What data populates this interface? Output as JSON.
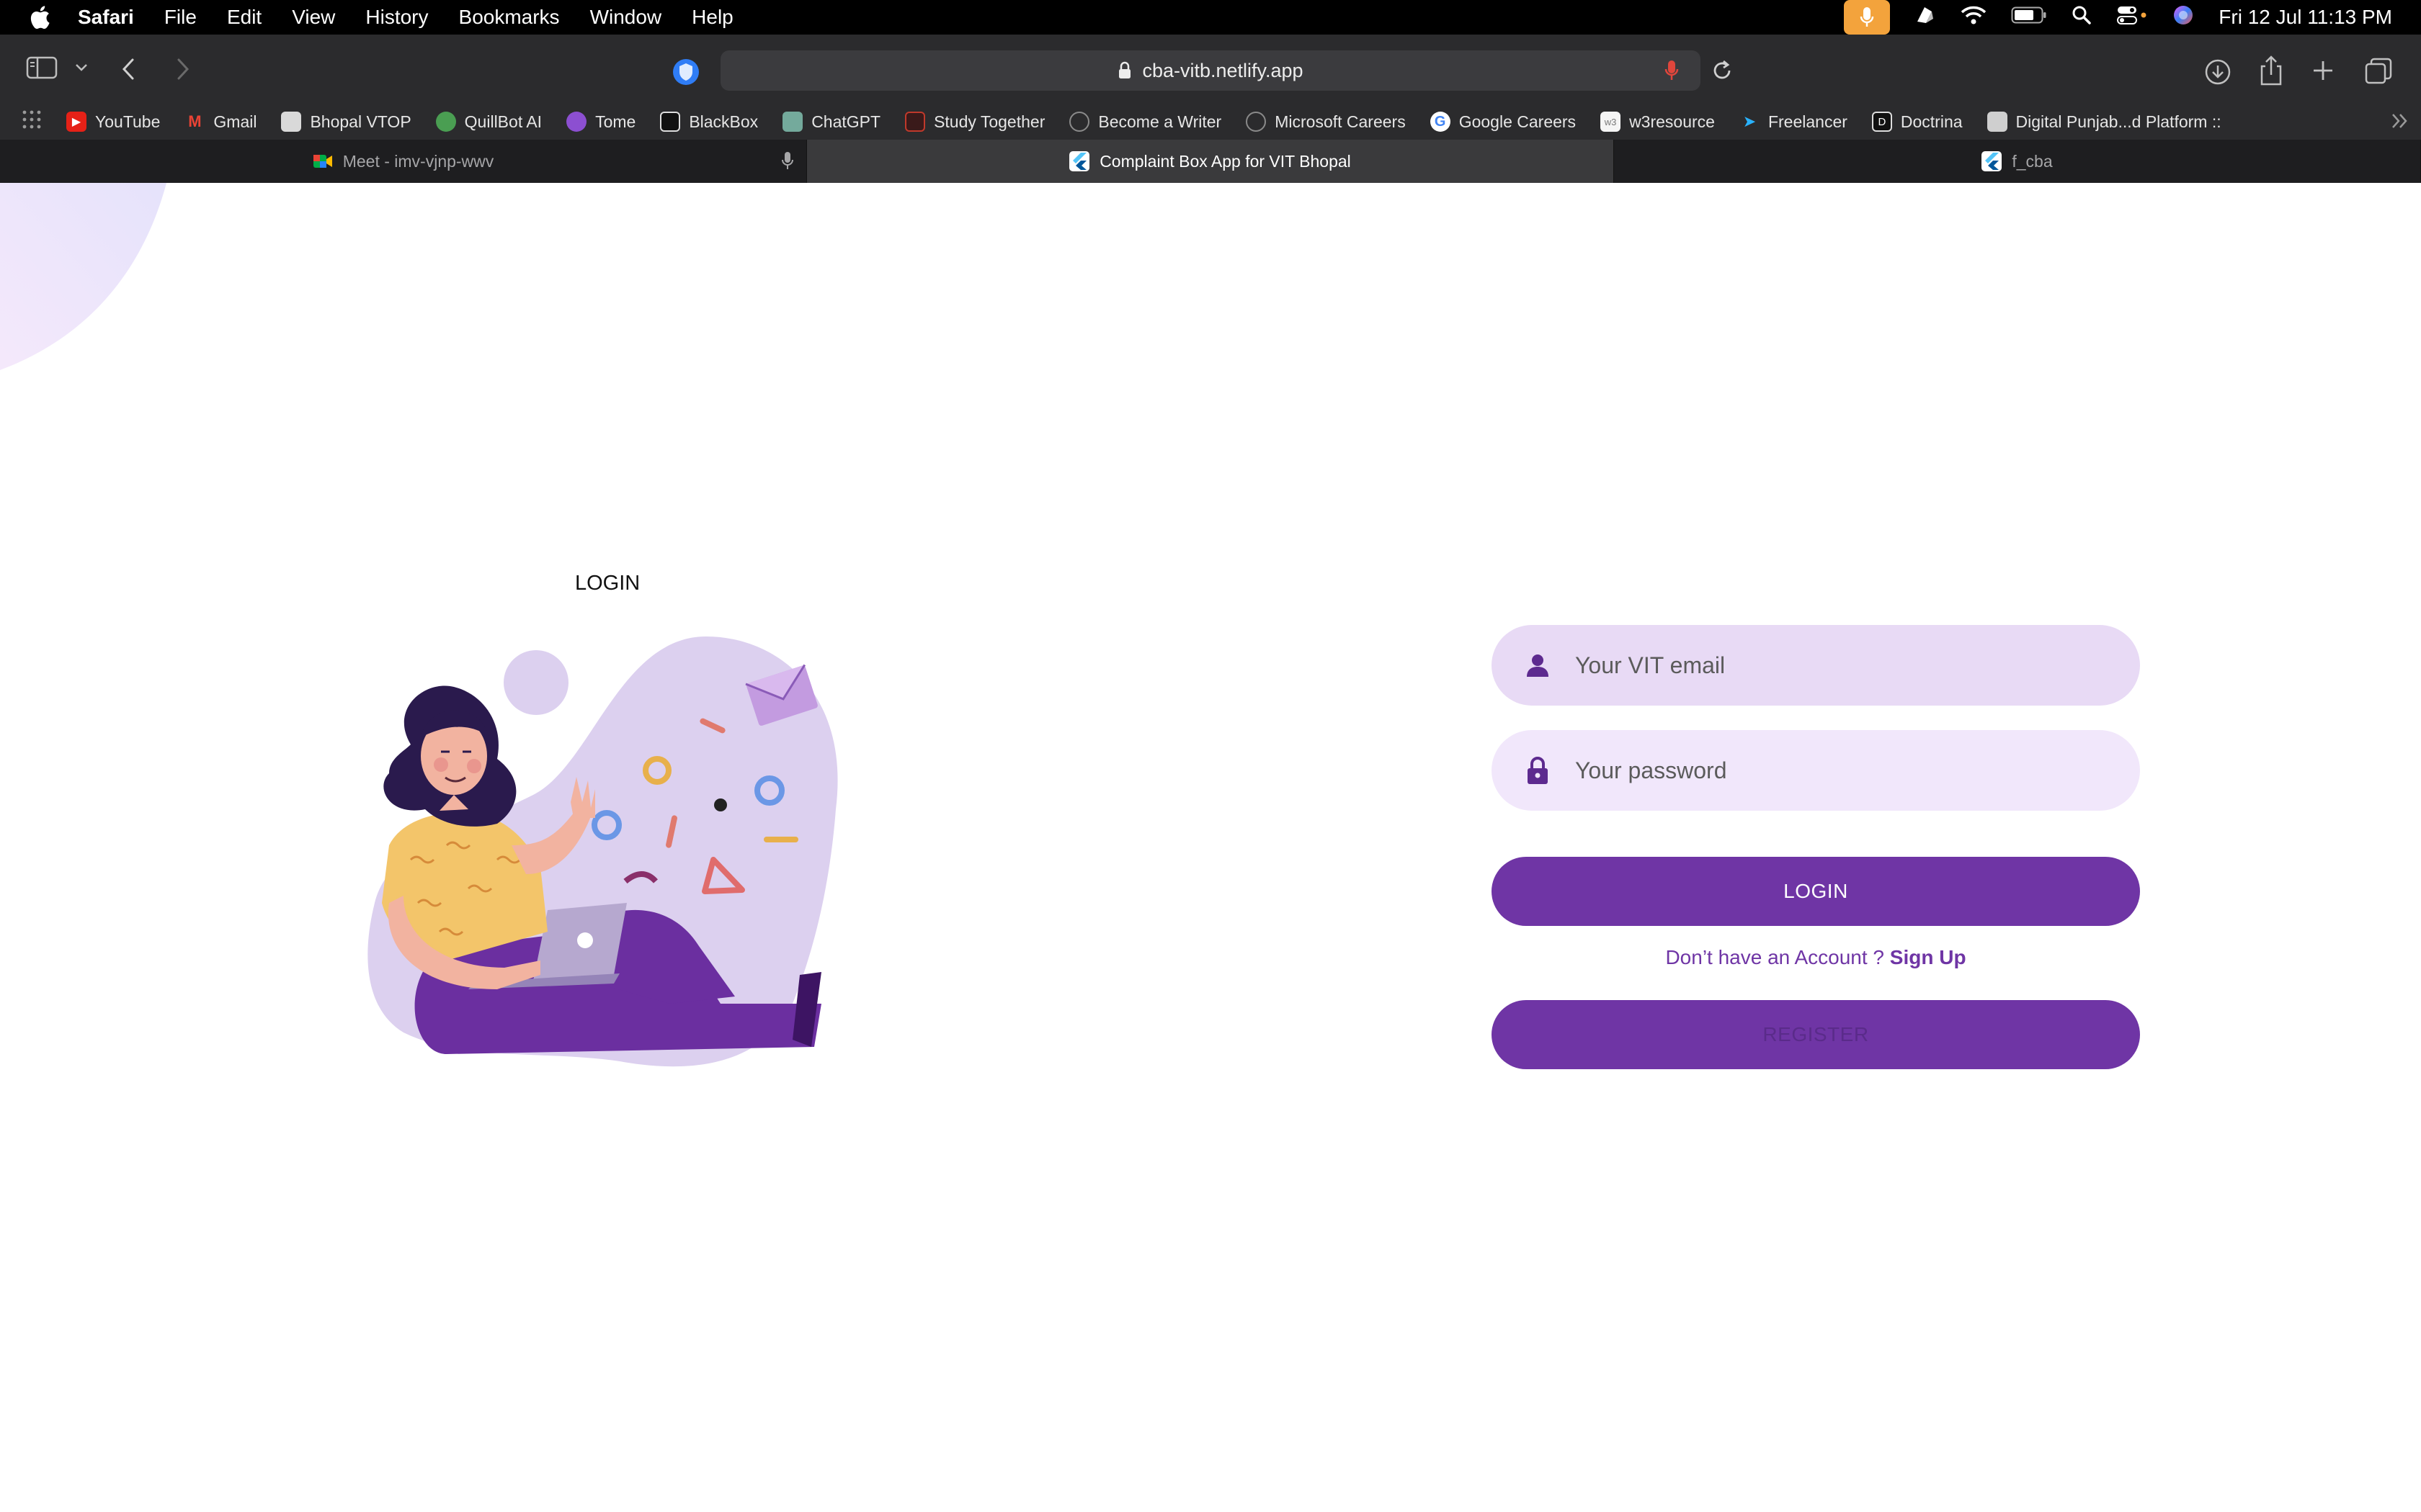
{
  "menubar": {
    "app_name": "Safari",
    "menus": [
      "File",
      "Edit",
      "View",
      "History",
      "Bookmarks",
      "Window",
      "Help"
    ],
    "clock": "Fri 12 Jul  11:13 PM"
  },
  "toolbar": {
    "url": "cba-vitb.netlify.app"
  },
  "bookmarks": [
    {
      "label": "YouTube",
      "icon": "youtube-icon",
      "color": "#e62117"
    },
    {
      "label": "Gmail",
      "icon": "gmail-icon",
      "color": "#ea4335"
    },
    {
      "label": "Bhopal VTOP",
      "icon": "vtop-icon",
      "color": "#8a8a8a"
    },
    {
      "label": "QuillBot AI",
      "icon": "quillbot-icon",
      "color": "#4a9e52"
    },
    {
      "label": "Tome",
      "icon": "tome-icon",
      "color": "#8c4fd1"
    },
    {
      "label": "BlackBox",
      "icon": "blackbox-icon",
      "color": "#111111"
    },
    {
      "label": "ChatGPT",
      "icon": "chatgpt-icon",
      "color": "#74aa9c"
    },
    {
      "label": "Study Together",
      "icon": "study-together-icon",
      "color": "#c0392b"
    },
    {
      "label": "Become a Writer",
      "icon": "globe-icon",
      "color": "#555555"
    },
    {
      "label": "Microsoft Careers",
      "icon": "globe-icon",
      "color": "#555555"
    },
    {
      "label": "Google Careers",
      "icon": "google-icon",
      "color": "#ffffff"
    },
    {
      "label": "w3resource",
      "icon": "w3resource-icon",
      "color": "#777777"
    },
    {
      "label": "Freelancer",
      "icon": "freelancer-icon",
      "color": "#29b2fe"
    },
    {
      "label": "Doctrina",
      "icon": "doctrina-icon",
      "color": "#111111"
    },
    {
      "label": "Digital Punjab...d Platform ::",
      "icon": "punjab-icon",
      "color": "#777777"
    }
  ],
  "tabs": [
    {
      "label": "Meet - imv-vjnp-wwv",
      "active": false
    },
    {
      "label": "Complaint Box App for VIT Bhopal",
      "active": true
    },
    {
      "label": "f_cba",
      "active": false
    }
  ],
  "page": {
    "title": "LOGIN",
    "email_placeholder": "Your VIT email",
    "password_placeholder": "Your password",
    "login_button": "LOGIN",
    "no_account_text": "Don’t have an Account ? ",
    "sign_up_link": "Sign Up",
    "register_button": "REGISTER",
    "accent_color": "#6f35a5"
  }
}
